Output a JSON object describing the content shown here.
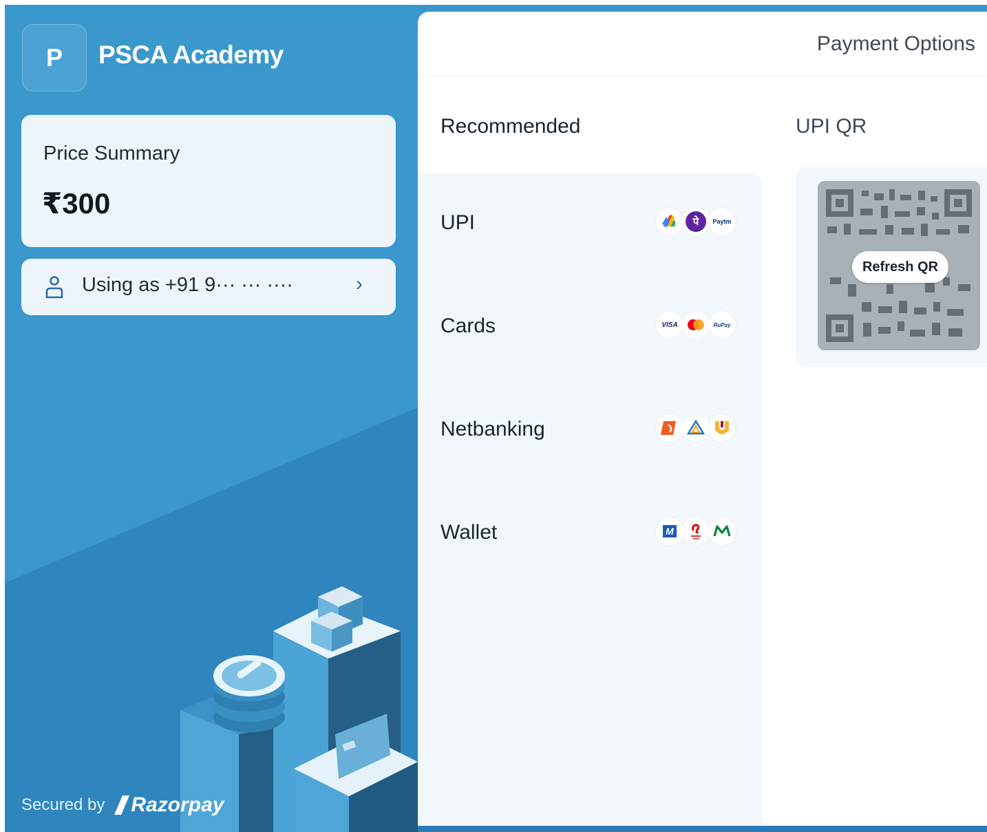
{
  "brand": {
    "logo_letter": "P",
    "name": "PSCA Academy"
  },
  "price_summary": {
    "label": "Price Summary",
    "amount": "₹300"
  },
  "user": {
    "text": "Using as +91 9··· ··· ····",
    "chevron": "›"
  },
  "footer": {
    "secured_by": "Secured by",
    "provider": "Razorpay"
  },
  "panel": {
    "title": "Payment Options",
    "recommended": "Recommended",
    "methods": [
      {
        "label": "UPI",
        "icons": [
          "google-pay-icon",
          "phonepe-icon",
          "paytm-icon"
        ]
      },
      {
        "label": "Cards",
        "icons": [
          "visa-icon",
          "mastercard-icon",
          "rupay-icon"
        ]
      },
      {
        "label": "Netbanking",
        "icons": [
          "bank-of-baroda-icon",
          "bank-of-india-icon",
          "punjab-national-bank-icon"
        ]
      },
      {
        "label": "Wallet",
        "icons": [
          "mobikwik-icon",
          "airtel-payments-icon",
          "jiomoney-icon"
        ]
      }
    ]
  },
  "upi_qr": {
    "title": "UPI QR",
    "refresh_label": "Refresh QR"
  },
  "icon_text": {
    "phonepe": "पे",
    "paytm": "Paytm",
    "visa": "VISA",
    "rupay": "RuPay",
    "mobikwik": "M"
  },
  "colors": {
    "brand_blue": "#3a98cc",
    "brand_dark": "#1f5b82",
    "panel_bg": "#ffffff",
    "card_bg": "#edf5fa",
    "methods_bg": "#f1f7fb"
  }
}
